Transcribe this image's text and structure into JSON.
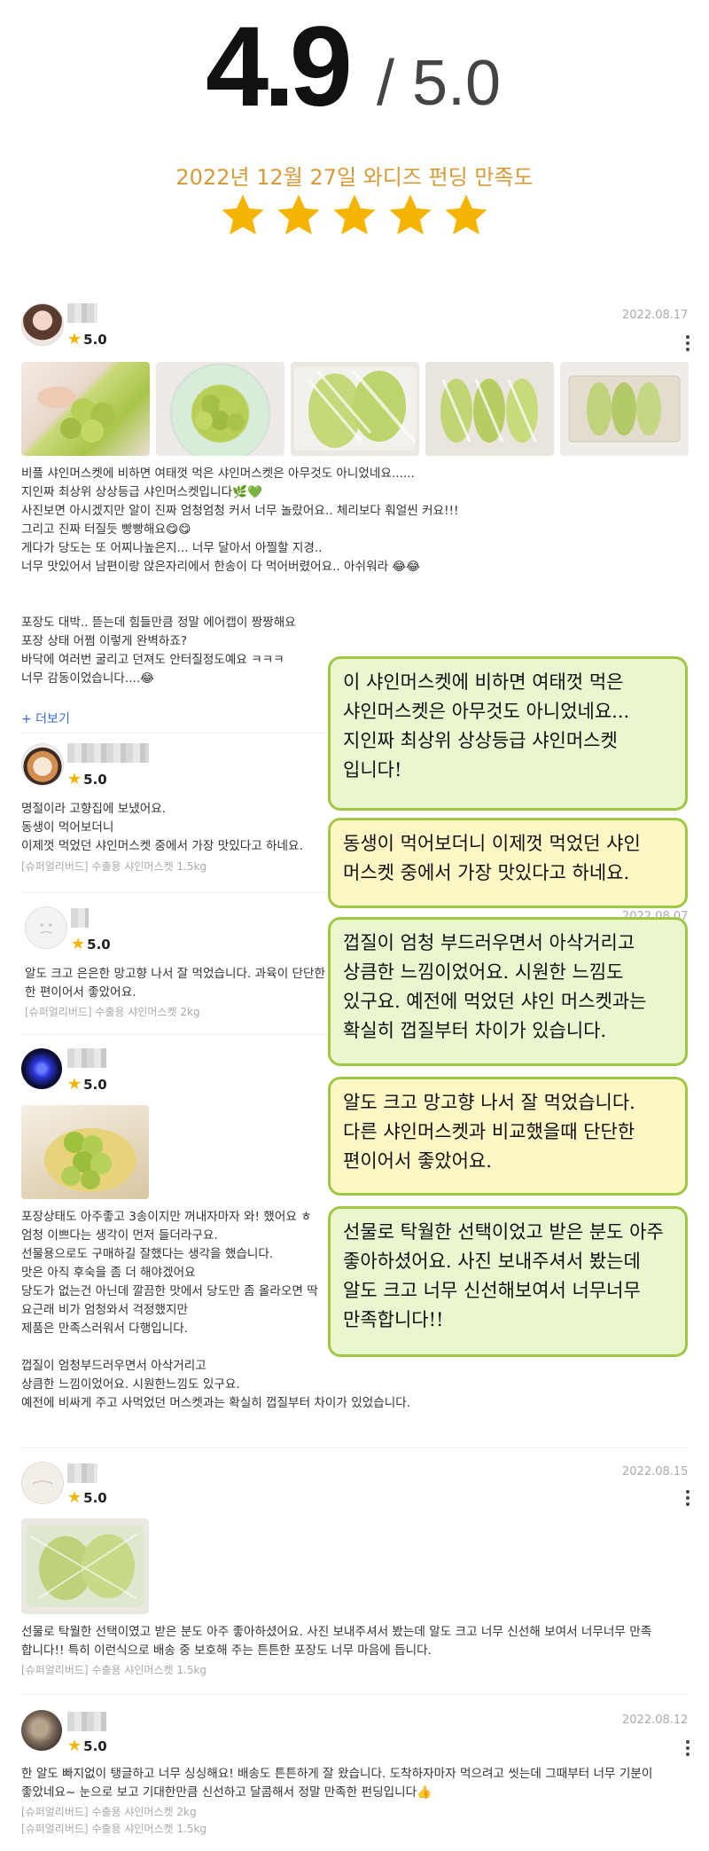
{
  "header": {
    "score": "4.9",
    "score_max": "/ 5.0",
    "funding_title": "2022년 12월 27일 와디즈 펀딩 만족도",
    "star_count": 5,
    "star_color": "#f4b400"
  },
  "reviews": [
    {
      "rating": "5.0",
      "date": "2022.08.17",
      "lines": [
        "비플 샤인머스켓에 비하면 여태껏 먹은 샤인머스켓은 아무것도 아니었네요......",
        "지인짜 최상위 상상등급 샤인머스켓입니다🌿💚",
        "사진보면 아시겠지만 알이 진짜 엄청엄청 커서 너무 놀랐어요.. 체리보다 훠얼씬 커요!!!",
        "그리고 진짜 터질듯 빵빵해요😋😋",
        "게다가 당도는 또 어찌나높은지... 너무 달아서 아찔할 지경..",
        "너무 맛있어서 남편이랑 앉은자리에서 한송이 다 먹어버렸어요.. 아쉬워라 😂😂",
        "",
        "",
        "포장도 대박.. 뜯는데 힘들만큼 정말 에어캡이 짱짱해요",
        "포장 상태 어쩜 이렇게 완벽하죠?",
        "바닥에 여러번 굴리고 던져도 안터질정도예요 ㅋㅋㅋ",
        "너무 감동이었습니다....😂"
      ],
      "more_label": "+ 더보기"
    },
    {
      "rating": "5.0",
      "lines": [
        "명절이라 고향집에 보냈어요.",
        "동생이 먹어보더니",
        "이제껏 먹었던 샤인머스켓 중에서 가장 맛있다고 하네요."
      ],
      "meta": [
        "[슈퍼얼리버드] 수출용 샤인머스켓 1.5kg"
      ]
    },
    {
      "rating": "5.0",
      "date_partial": "2022.08.07",
      "lines": [
        "알도 크고 은은한 망고향 나서 잘 먹었습니다. 과육이 단단한",
        "한 편이어서 좋았어요."
      ],
      "meta": [
        "[슈퍼얼리버드] 수출용 샤인머스켓 2kg"
      ]
    },
    {
      "rating": "5.0",
      "lines": [
        "포장상태도 아주좋고 3송이지만 꺼내자마자 와! 했어요 ㅎ",
        "엄청 이쁘다는 생각이 먼저 들더라구요.",
        "선물용으로도 구매하길 잘했다는 생각을 했습니다.",
        "맛은 아직 후숙을 좀 더 해야겠어요",
        "당도가 없는건 아닌데 깔끔한 맛에서 당도만 좀 올라오면 딱",
        "요근래 비가 엄청와서 걱정했지만",
        "제품은 만족스러워서 다행입니다.",
        "",
        "껍질이 엄청부드러우면서 아삭거리고",
        "상큼한 느낌이었어요. 시원한느낌도 있구요.",
        "예전에 비싸게 주고 사먹었던 머스켓과는 확실히 껍질부터 차이가 있었습니다."
      ]
    },
    {
      "rating": "5.0",
      "date": "2022.08.15",
      "lines": [
        "선물로 탁월한 선택이였고 받은 분도 아주 좋아하셨어요. 사진 보내주셔서 봤는데 알도 크고 너무 신선해 보여서 너무너무 만족",
        "합니다!! 특히 이런식으로 배송 중 보호해 주는 튼튼한 포장도 너무 마음에 듭니다."
      ],
      "meta": [
        "[슈퍼얼리버드] 수출용 샤인머스켓 1.5kg"
      ]
    },
    {
      "rating": "5.0",
      "date": "2022.08.12",
      "lines": [
        "한 알도 빠지없이 탱글하고 너무 싱싱해요! 배송도 튼튼하게 잘 왔습니다. 도착하자마자 먹으려고 씻는데 그때부터 너무 기분이",
        "좋았네요~ 눈으로 보고 기대한만큼 신선하고 달콤해서 정말 만족한 펀딩입니다👍"
      ],
      "meta": [
        "[슈퍼얼리버드] 수출용 샤인머스켓 2kg",
        "[슈퍼얼리버드] 수출용 샤인머스켓 1.5kg"
      ]
    }
  ],
  "callouts": [
    {
      "lines": [
        "이 샤인머스켓에 비하면 여태껏 먹은",
        "샤인머스켓은 아무것도 아니었네요...",
        "지인짜 최상위 상상등급 샤인머스켓",
        "입니다!"
      ],
      "bg": "#e9f6cf"
    },
    {
      "lines": [
        "동생이 먹어보더니 이제껏 먹었던 샤인",
        "머스켓 중에서 가장 맛있다고 하네요."
      ],
      "bg": "#fdf6c5"
    },
    {
      "lines": [
        "껍질이 엄청 부드러우면서 아삭거리고",
        "상큼한 느낌이었어요. 시원한 느낌도",
        "있구요. 예전에 먹었던 샤인 머스켓과는",
        "확실히 껍질부터 차이가 있습니다."
      ],
      "bg": "#e9f6cf"
    },
    {
      "lines": [
        "알도 크고 망고향 나서 잘 먹었습니다.",
        "다른 샤인머스켓과 비교했을때 단단한",
        "편이어서 좋았어요."
      ],
      "bg": "#fdf6c5"
    },
    {
      "lines": [
        "선물로 탁월한 선택이었고 받은 분도 아주",
        "좋아하셨어요. 사진 보내주셔서 봤는데",
        "알도 크고 너무 신선해보여서 너무너무",
        "만족합니다!!"
      ],
      "bg": "#e9f6cf"
    }
  ]
}
